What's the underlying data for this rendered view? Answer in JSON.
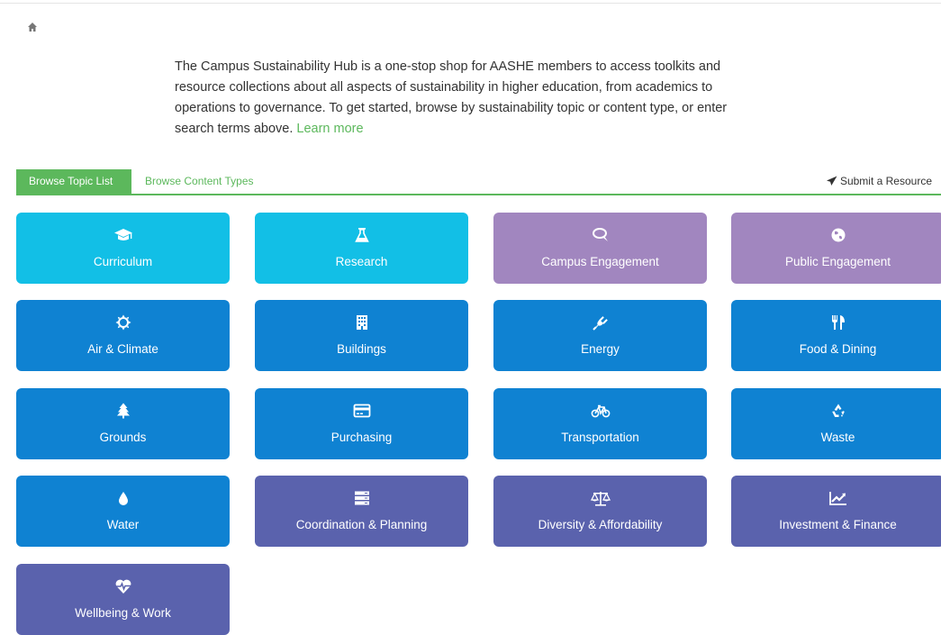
{
  "intro": {
    "text": "The Campus Sustainability Hub is a one-stop shop for AASHE members to access toolkits and resource collections about all aspects of sustainability in higher education, from academics to operations to governance. To get started, browse by sustainability topic or content type, or enter search terms above.",
    "link": "Learn more"
  },
  "tabs": {
    "active": "Browse Topic List",
    "inactive": "Browse Content Types",
    "submit": "Submit a Resource"
  },
  "colors": {
    "accent_green": "#5cb85c",
    "tile_light_blue": "#12bfe6",
    "tile_purple": "#a186bf",
    "tile_blue": "#0f82d2",
    "tile_indigo": "#5a62ad"
  },
  "topics": [
    {
      "label": "Curriculum",
      "icon": "graduation-cap-icon",
      "color": "light-blue"
    },
    {
      "label": "Research",
      "icon": "flask-icon",
      "color": "light-blue"
    },
    {
      "label": "Campus Engagement",
      "icon": "chat-bubble-icon",
      "color": "purple"
    },
    {
      "label": "Public Engagement",
      "icon": "globe-icon",
      "color": "purple"
    },
    {
      "label": "Air & Climate",
      "icon": "sun-icon",
      "color": "blue"
    },
    {
      "label": "Buildings",
      "icon": "building-icon",
      "color": "blue"
    },
    {
      "label": "Energy",
      "icon": "plug-icon",
      "color": "blue"
    },
    {
      "label": "Food & Dining",
      "icon": "cutlery-icon",
      "color": "blue"
    },
    {
      "label": "Grounds",
      "icon": "tree-icon",
      "color": "blue"
    },
    {
      "label": "Purchasing",
      "icon": "credit-card-icon",
      "color": "blue"
    },
    {
      "label": "Transportation",
      "icon": "bicycle-icon",
      "color": "blue"
    },
    {
      "label": "Waste",
      "icon": "recycle-icon",
      "color": "blue"
    },
    {
      "label": "Water",
      "icon": "water-drop-icon",
      "color": "blue"
    },
    {
      "label": "Coordination & Planning",
      "icon": "server-icon",
      "color": "indigo"
    },
    {
      "label": "Diversity & Affordability",
      "icon": "balance-scale-icon",
      "color": "indigo"
    },
    {
      "label": "Investment & Finance",
      "icon": "line-chart-icon",
      "color": "indigo"
    },
    {
      "label": "Wellbeing & Work",
      "icon": "heartbeat-icon",
      "color": "indigo"
    }
  ]
}
